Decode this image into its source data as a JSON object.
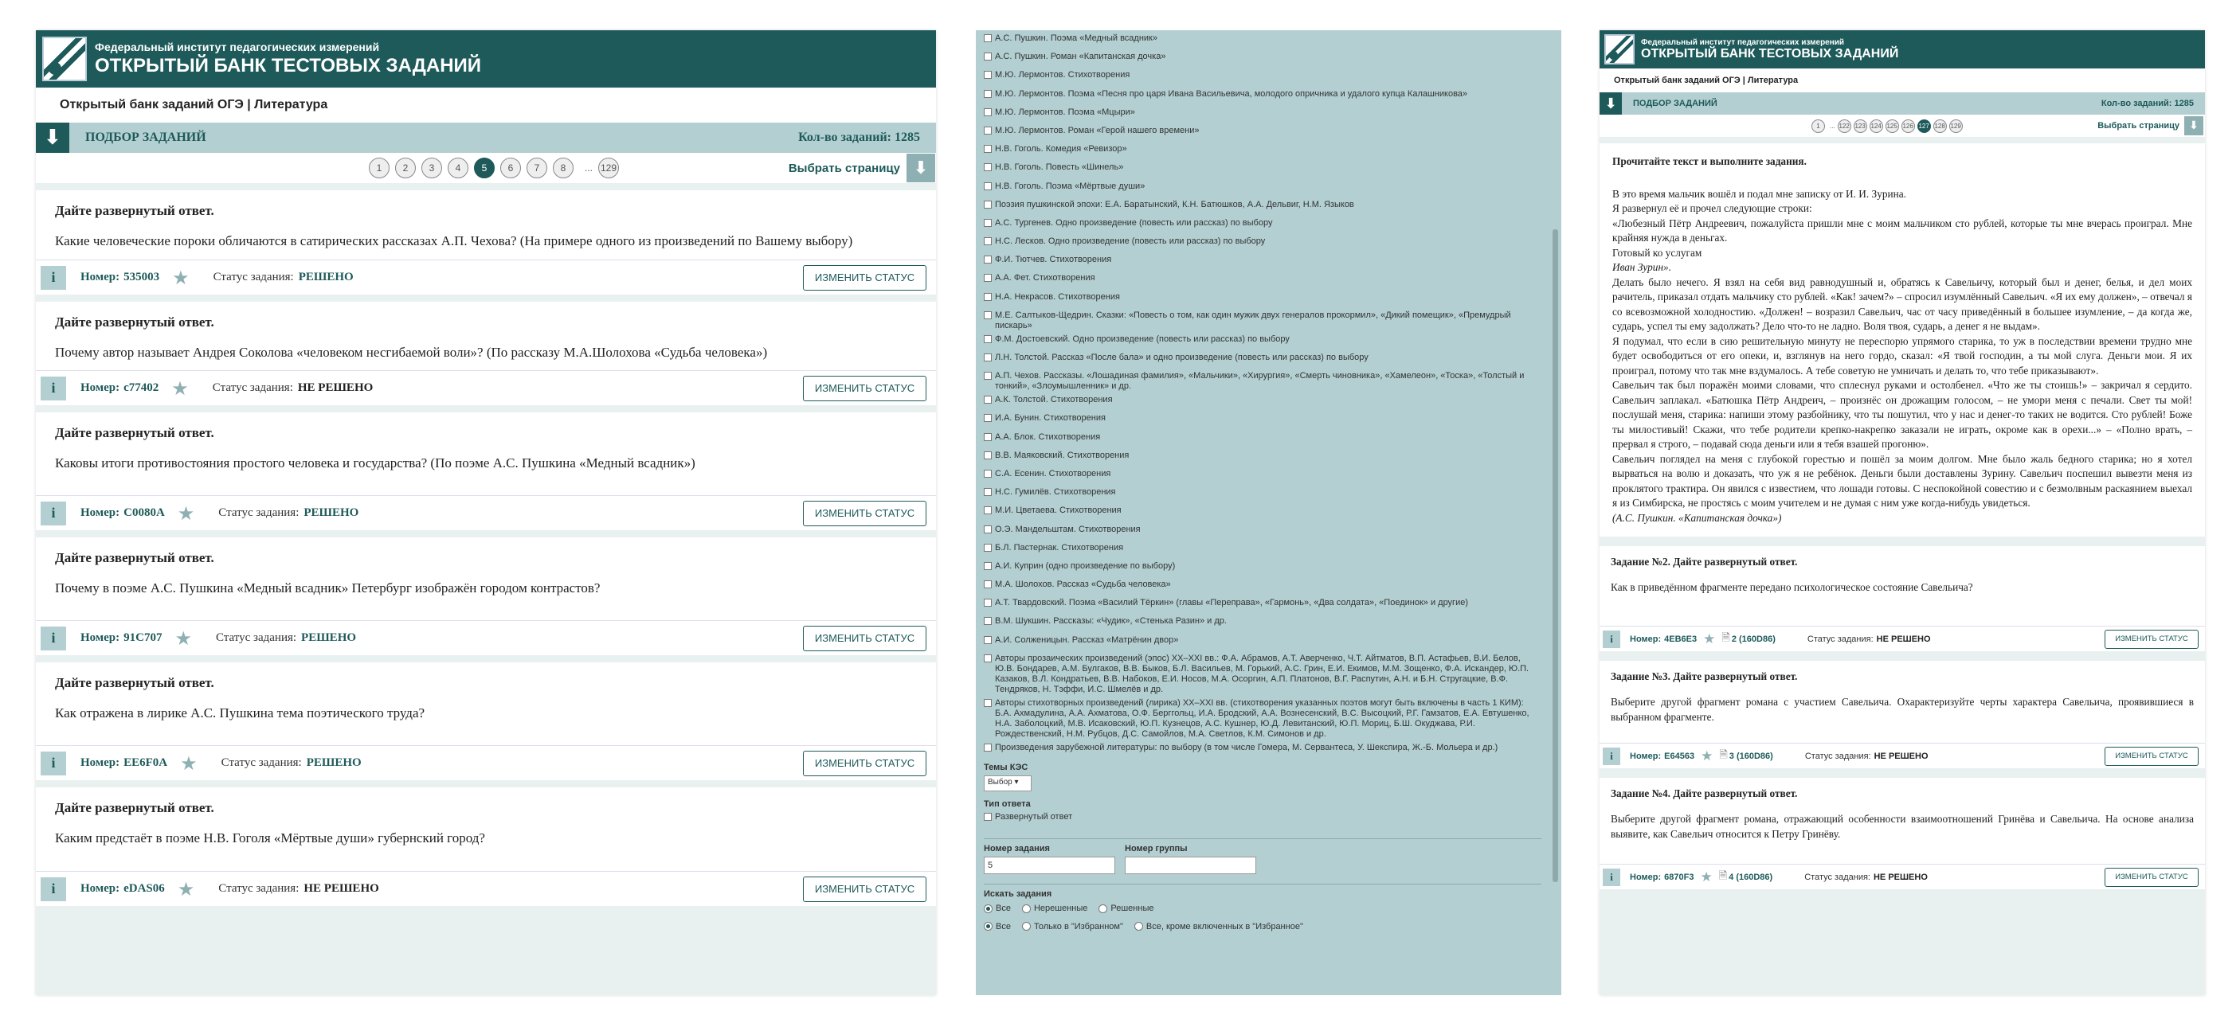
{
  "site": {
    "sub": "Федеральный институт педагогических измерений",
    "main": "ОТКРЫТЫЙ БАНК ТЕСТОВЫХ ЗАДАНИЙ"
  },
  "p1": {
    "breadcrumb": "Открытый банк заданий ОГЭ | Литература",
    "selection": "ПОДБОР ЗАДАНИЙ",
    "count_label": "Кол-во заданий: 1285",
    "pages": [
      "1",
      "2",
      "3",
      "4",
      "5",
      "6",
      "7",
      "8",
      "...",
      "129"
    ],
    "current_page": "5",
    "choose_page": "Выбрать страницу",
    "change_status": "ИЗМЕНИТЬ СТАТУС",
    "number_prefix": "Номер:",
    "status_label": "Статус задания:",
    "cards": [
      {
        "title": "Дайте развернутый ответ.",
        "question": "Какие человеческие пороки обличаются в сатирических рассказах А.П. Чехова? (На примере одного из произведений по Вашему выбору)",
        "number": "535003",
        "status": "РЕШЕНО"
      },
      {
        "title": "Дайте развернутый ответ.",
        "question": "Почему автор называет Андрея Соколова «человеком несгибаемой воли»? (По рассказу М.А.Шолохова «Судьба человека»)",
        "number": "c77402",
        "status": "НЕ РЕШЕНО"
      },
      {
        "title": "Дайте развернутый ответ.",
        "question": "Каковы итоги противостояния простого человека и государства? (По поэме А.С. Пушкина «Медный всадник»)",
        "number": "C0080A",
        "status": "РЕШЕНО"
      },
      {
        "title": "Дайте развернутый ответ.",
        "question": "Почему в поэме А.С. Пушкина «Медный всадник» Петербург изображён городом контрастов?",
        "number": "91C707",
        "status": "РЕШЕНО"
      },
      {
        "title": "Дайте развернутый ответ.",
        "question": "Как отражена в лирике А.С. Пушкина тема поэтического труда?",
        "number": "EE6F0A",
        "status": "РЕШЕНО"
      },
      {
        "title": "Дайте развернутый ответ.",
        "question": "Каким предстаёт в поэме Н.В. Гоголя «Мёртвые души» губернский город?",
        "number": "eDAS06",
        "status": "НЕ РЕШЕНО"
      }
    ]
  },
  "p2": {
    "items": [
      "А.С. Пушкин. Поэма «Медный всадник»",
      "А.С. Пушкин. Роман «Капитанская дочка»",
      "М.Ю. Лермонтов. Стихотворения",
      "М.Ю. Лермонтов. Поэма «Песня про царя Ивана Васильевича, молодого опричника и удалого купца Калашникова»",
      "М.Ю. Лермонтов. Поэма «Мцыри»",
      "М.Ю. Лермонтов. Роман «Герой нашего времени»",
      "Н.В. Гоголь. Комедия «Ревизор»",
      "Н.В. Гоголь. Повесть «Шинель»",
      "Н.В. Гоголь. Поэма «Мёртвые души»",
      "Поэзия пушкинской эпохи: Е.А. Баратынский, К.Н. Батюшков, А.А. Дельвиг, Н.М. Языков",
      "А.С. Тургенев. Одно произведение (повесть или рассказ) по выбору",
      "Н.С. Лесков. Одно произведение (повесть или рассказ) по выбору",
      "Ф.И. Тютчев. Стихотворения",
      "А.А. Фет. Стихотворения",
      "Н.А. Некрасов. Стихотворения",
      "М.Е. Салтыков-Щедрин. Сказки: «Повесть о том, как один мужик двух генералов прокормил», «Дикий помещик», «Премудрый пискарь»",
      "Ф.М. Достоевский. Одно произведение (повесть или рассказ) по выбору",
      "Л.Н. Толстой. Рассказ «После бала» и одно произведение (повесть или рассказ) по выбору",
      "А.П. Чехов. Рассказы. «Лошадиная фамилия», «Мальчики», «Хирургия», «Смерть чиновника», «Хамелеон», «Тоска», «Толстый и тонкий», «Злоумышленник» и др.",
      "А.К. Толстой. Стихотворения",
      "И.А. Бунин. Стихотворения",
      "А.А. Блок. Стихотворения",
      "В.В. Маяковский. Стихотворения",
      "С.А. Есенин. Стихотворения",
      "Н.С. Гумилёв. Стихотворения",
      "М.И. Цветаева. Стихотворения",
      "О.Э. Мандельштам. Стихотворения",
      "Б.Л. Пастернак. Стихотворения",
      "А.И. Куприн (одно произведение по выбору)",
      "М.А. Шолохов. Рассказ «Судьба человека»",
      "А.Т. Твардовский. Поэма «Василий Тёркин» (главы «Переправа», «Гармонь», «Два солдата», «Поединок» и другие)",
      "В.М. Шукшин. Рассказы: «Чудик», «Стенька Разин» и др.",
      "А.И. Солженицын. Рассказ «Матрёнин двор»",
      "Авторы прозаических произведений (эпос) XX–XXI вв.: Ф.А. Абрамов, А.Т. Аверченко, Ч.Т. Айтматов, В.П. Астафьев, В.И. Белов, Ю.В. Бондарев, А.М. Булгаков, В.В. Быков, Б.Л. Васильев, М. Горький, А.С. Грин, Е.И. Екимов, М.М. Зощенко, Ф.А. Искандер, Ю.П. Казаков, В.Л. Кондратьев, В.В. Набоков, Е.И. Носов, М.А. Осоргин, А.П. Платонов, В.Г. Распутин, А.Н. и Б.Н. Стругацкие, В.Ф. Тендряков, Н. Тэффи, И.С. Шмелёв и др.",
      "Авторы стихотворных произведений (лирика) XX–XXI вв. (стихотворения указанных поэтов могут быть включены в часть 1 КИМ): Б.А. Ахмадулина, А.А. Ахматова, О.Ф. Берггольц, И.А. Бродский, А.А. Вознесенский, В.С. Высоцкий, Р.Г. Гамзатов, Е.А. Евтушенко, Н.А. Заболоцкий, М.В. Исаковский, Ю.П. Кузнецов, А.С. Кушнер, Ю.Д. Левитанский, Ю.П. Мориц, Б.Ш. Окуджава, Р.И. Рождественский, Н.М. Рубцов, Д.С. Самойлов, М.А. Светлов, К.М. Симонов и др.",
      "Произведения зарубежной литературы: по выбору (в том числе Гомера, М. Сервантеса, У. Шекспира, Ж.-Б. Мольера и др.)"
    ],
    "theme_label": "Темы КЭС",
    "theme_select": "Выбор ▾",
    "answer_type_label": "Тип ответа",
    "answer_type_option": "Развернутый ответ",
    "task_number_label": "Номер задания",
    "task_number_value": "5",
    "group_number_label": "Номер группы",
    "search_label": "Искать задания",
    "radios1": [
      "Все",
      "Нерешенные",
      "Решенные"
    ],
    "radios2": [
      "Все",
      "Только в \"Избранном\"",
      "Все, кроме включенных в \"Избранное\""
    ]
  },
  "p3": {
    "breadcrumb": "Открытый банк заданий ОГЭ | Литература",
    "selection": "ПОДБОР ЗАДАНИЙ",
    "count_label": "Кол-во заданий: 1285",
    "pages": [
      "1",
      "...",
      "122",
      "123",
      "124",
      "125",
      "126",
      "127",
      "128",
      "129"
    ],
    "current_page": "127",
    "choose_page": "Выбрать страницу",
    "intro": "Прочитайте текст и выполните задания.",
    "lines": [
      "В это время мальчик вошёл и подал мне записку от И. И. Зурина.",
      "Я развернул её и прочел следующие строки:",
      "«Любезный Пётр Андреевич, пожалуйста пришли мне с моим мальчиком сто рублей, которые ты мне вчерась проиграл. Мне крайняя нужда в деньгах.",
      "Готовый ко услугам"
    ],
    "signature": "Иван Зурин».",
    "body": "Делать было нечего. Я взял на себя вид равнодушный и, обратясь к Савельичу, который был и денег, белья, и дел моих рачитель, приказал отдать мальчику сто рублей. «Как! зачем?» – спросил изумлённый Савельич. «Я их ему должен», – отвечал я со всевозможной холодностию. «Должен! – возразил Савельич, час от часу приведённый в большее изумление, – да когда же, сударь, успел ты ему задолжать? Дело что-то не ладно. Воля твоя, сударь, а денег я не выдам».",
    "body2": "Я подумал, что если в сию решительную минуту не переспорю упрямого старика, то уж в последствии времени трудно мне будет освободиться от его опеки, и, взглянув на него гордо, сказал: «Я твой господин, а ты мой слуга. Деньги мои. Я их проиграл, потому что так мне вздумалось. А тебе советую не умничать и делать то, что тебе приказывают».",
    "body3": "Савельич так был поражён моими словами, что сплеснул руками и остолбенел. «Что же ты стоишь!» – закричал я сердито. Савельич заплакал. «Батюшка Пётр Андреич, – произнёс он дрожащим голосом, – не умори меня с печали. Свет ты мой! послушай меня, старика: напиши этому разбойнику, что ты пошутил, что у нас и денег-то таких не водится. Сто рублей! Боже ты милостивый! Скажи, что тебе родители крепко-накрепко заказали не играть, окроме как в орехи...» – «Полно врать, – прервал я строго, – подавай сюда деньги или я тебя взашей прогоню».",
    "body4": "Савельич поглядел на меня с глубокой горестью и пошёл за моим долгом. Мне было жаль бедного старика; но я хотел вырваться на волю и доказать, что уж я не ребёнок. Деньги были доставлены Зурину. Савельич поспешил вывезти меня из проклятого трактира. Он явился с известием, что лошади готовы. С неспокойной совестию и с безмолвным раскаянием выехал я из Симбирска, не простясь с моим учителем и не думая с ним уже когда-нибудь увидеться.",
    "source": "(А.С. Пушкин. «Капитанская дочка»)",
    "tasks": [
      {
        "title": "Задание №2. Дайте развернутый ответ.",
        "question": "Как в приведённом фрагменте передано психологическое состояние Савельича?",
        "number": "4EB6E3",
        "group": "2 (160D86)",
        "status": "НЕ РЕШЕНО"
      },
      {
        "title": "Задание №3. Дайте развернутый ответ.",
        "question": "Выберите другой фрагмент романа с участием Савельича. Охарактеризуйте черты характера Савельича, проявившиеся в выбранном фрагменте.",
        "number": "E64563",
        "group": "3 (160D86)",
        "status": "НЕ РЕШЕНО"
      },
      {
        "title": "Задание №4. Дайте развернутый ответ.",
        "question": "Выберите другой фрагмент романа, отражающий особенности взаимоотношений Гринёва и Савельича. На основе анализа выявите, как Савельич относится к Петру Гринёву.",
        "number": "6870F3",
        "group": "4 (160D86)",
        "status": "НЕ РЕШЕНО"
      }
    ]
  }
}
